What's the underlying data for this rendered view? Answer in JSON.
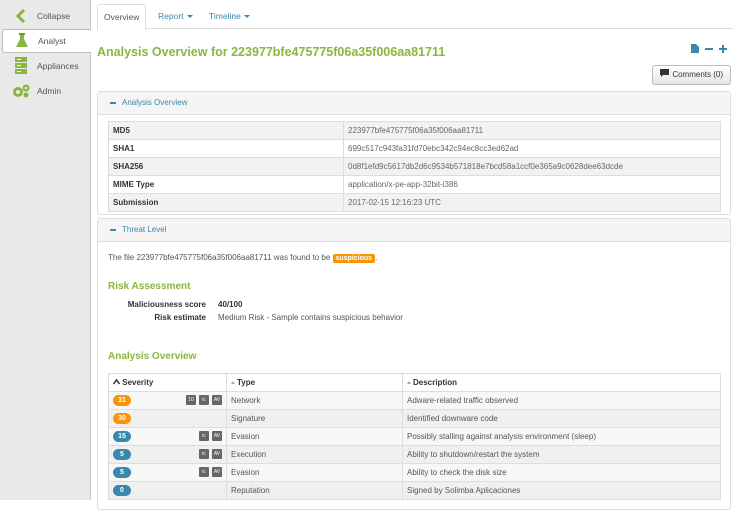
{
  "sidebar": {
    "items": [
      {
        "label": "Collapse",
        "icon": "chevron-left-icon",
        "color": "#8ab53f"
      },
      {
        "label": "Analyst",
        "icon": "flask-icon",
        "color": "#8ab53f"
      },
      {
        "label": "Appliances",
        "icon": "server-icon",
        "color": "#8ab53f"
      },
      {
        "label": "Admin",
        "icon": "gears-icon",
        "color": "#8ab53f"
      }
    ]
  },
  "tabs": [
    {
      "label": "Overview"
    },
    {
      "label": "Report"
    },
    {
      "label": "Timeline"
    }
  ],
  "page_title": "Analysis Overview for 223977bfe475775f06a35f006aa81711",
  "comments_button": "Comments (0)",
  "overview_panel": {
    "heading": "Analysis Overview",
    "rows": [
      {
        "key": "MD5",
        "value": "223977bfe475775f06a35f006aa81711"
      },
      {
        "key": "SHA1",
        "value": "699c517c943fa31fd70ebc342c94ec8cc3ed62ad"
      },
      {
        "key": "SHA256",
        "value": "0d8f1efd9c5617db2d6c9534b571818e7bcd58a1ccf0e365a9c0628dee63dcde"
      },
      {
        "key": "MIME Type",
        "value": "application/x-pe-app-32bit-i386"
      },
      {
        "key": "Submission",
        "value": "2017-02-15 12:16:23 UTC"
      }
    ]
  },
  "threat_panel": {
    "heading": "Threat Level",
    "found_prefix": "The file 223977bfe475775f06a35f006aa81711 was found to be",
    "verdict": "suspicious",
    "found_suffix": ".",
    "risk_heading": "Risk Assessment",
    "maliciousness_label": "Maliciousness score",
    "maliciousness_value": "40/100",
    "risk_estimate_label": "Risk estimate",
    "risk_estimate_value": "Medium Risk - Sample contains suspicious behavior",
    "ao_heading": "Analysis Overview",
    "columns": [
      "Severity",
      "Type",
      "Description"
    ],
    "signatures": [
      {
        "severity": "31",
        "color": "#f89406",
        "ops": [
          "10",
          "ic",
          "AV"
        ],
        "type": "Network",
        "description": "Adware-related traffic observed"
      },
      {
        "severity": "30",
        "color": "#f89406",
        "ops": [],
        "type": "Signature",
        "description": "Identified downware code"
      },
      {
        "severity": "15",
        "color": "#3a87ad",
        "ops": [
          "ic",
          "AV"
        ],
        "type": "Evasion",
        "description": "Possibly stalling against analysis environment (sleep)"
      },
      {
        "severity": "5",
        "color": "#3a87ad",
        "ops": [
          "ic",
          "AV"
        ],
        "type": "Execution",
        "description": "Ability to shutdown/restart the system"
      },
      {
        "severity": "5",
        "color": "#3a87ad",
        "ops": [
          "ic",
          "AV"
        ],
        "type": "Evasion",
        "description": "Ability to check the disk size"
      },
      {
        "severity": "0",
        "color": "#3a87ad",
        "ops": [],
        "type": "Reputation",
        "description": "Signed by Solimba Aplicaciones"
      }
    ]
  }
}
